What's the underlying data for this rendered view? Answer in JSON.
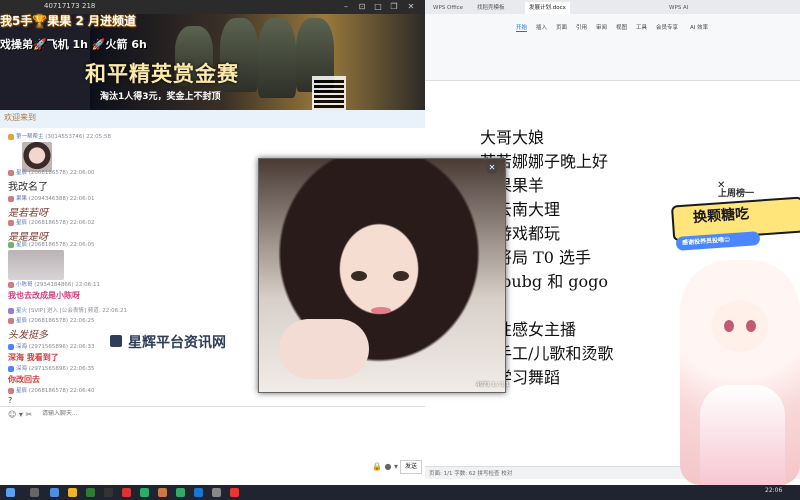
{
  "overlay": {
    "line1": "我5手🏆果果 2 月进频道",
    "line2": "戏操弟🚀飞机 1h 🚀火箭 6h"
  },
  "chat_window": {
    "titlebar_number": "40717173",
    "titlebar_count": "218",
    "banner": {
      "title": "和平精英赏金赛",
      "subtitle": "淘汰1人得3元，奖金上不封顶"
    },
    "notice": "欢迎来到",
    "messages": [
      {
        "name": "第一帮帮主",
        "meta": "(3014553746) 22:05:58",
        "body": "",
        "has_image": true
      },
      {
        "name": "星辰",
        "meta": "(2068186578) 22:06:00",
        "body": "我改名了",
        "style": "normal"
      },
      {
        "name": "果果",
        "meta": "(2094346388) 22:06:01",
        "body": "是若若呀",
        "style": "hand"
      },
      {
        "name": "星辰",
        "meta": "(2068186578) 22:06:02",
        "body": "是是是呀",
        "style": "hand"
      },
      {
        "name": "星辰",
        "meta": "(2068186578) 22:06:05",
        "body": "",
        "has_image": true
      },
      {
        "name": "小陈哥",
        "meta": "(2934184866) 22:06:11",
        "body": "我也去改成是小陈呀",
        "style": "pink"
      },
      {
        "name": "星火",
        "meta": "[SVIP] 进入 [公会表情] 频道. 22:06:21",
        "body": "",
        "style": "normal"
      },
      {
        "name": "星辰",
        "meta": "(2068186578) 22:06:25",
        "body": "头发挺多",
        "style": "hand"
      },
      {
        "name": "深海",
        "meta": "(2971565896) 22:06:33",
        "body": "深海   我看到了",
        "style": "red"
      },
      {
        "name": "深海",
        "meta": "(2971565896) 22:06:35",
        "body": "你改回去",
        "style": "red"
      },
      {
        "name": "星辰",
        "meta": "(2068186578) 22:06:40",
        "body": "?",
        "style": "normal"
      }
    ],
    "input_placeholder": "请输入聊天...",
    "send_label": "发送"
  },
  "watermark": "星辉平台资讯网",
  "popup": {
    "caption": "4971 1 / 1 1",
    "close_icon": "close-icon"
  },
  "wps": {
    "tabs": [
      "WPS Office",
      "找稻壳模板",
      "发展计划.docx",
      "WPS AI"
    ],
    "ribbon_menu": [
      "开始",
      "插入",
      "页面",
      "引用",
      "审阅",
      "视图",
      "工具",
      "会员专享",
      "AI 效率"
    ],
    "doc_lines": [
      "大哥大娘",
      "若若娜娜子晚上好",
      "是果果羊",
      "居云南大理",
      "么游戏都玩",
      "中将局 T0 选手",
      "玩 pubg 和 gogo",
      "",
      "绝性感女主播",
      "欢手工/儿歌和烫歌",
      "备学习舞蹈"
    ],
    "status": "页面: 1/1  字数: 62  拼写检查  校对"
  },
  "vtuber": {
    "weekly_label": "上周榜一",
    "badge_title": "换颗糖吃",
    "badge_sub": "感谢投养员投喂😊"
  },
  "taskbar": {
    "clock": "22:06"
  }
}
